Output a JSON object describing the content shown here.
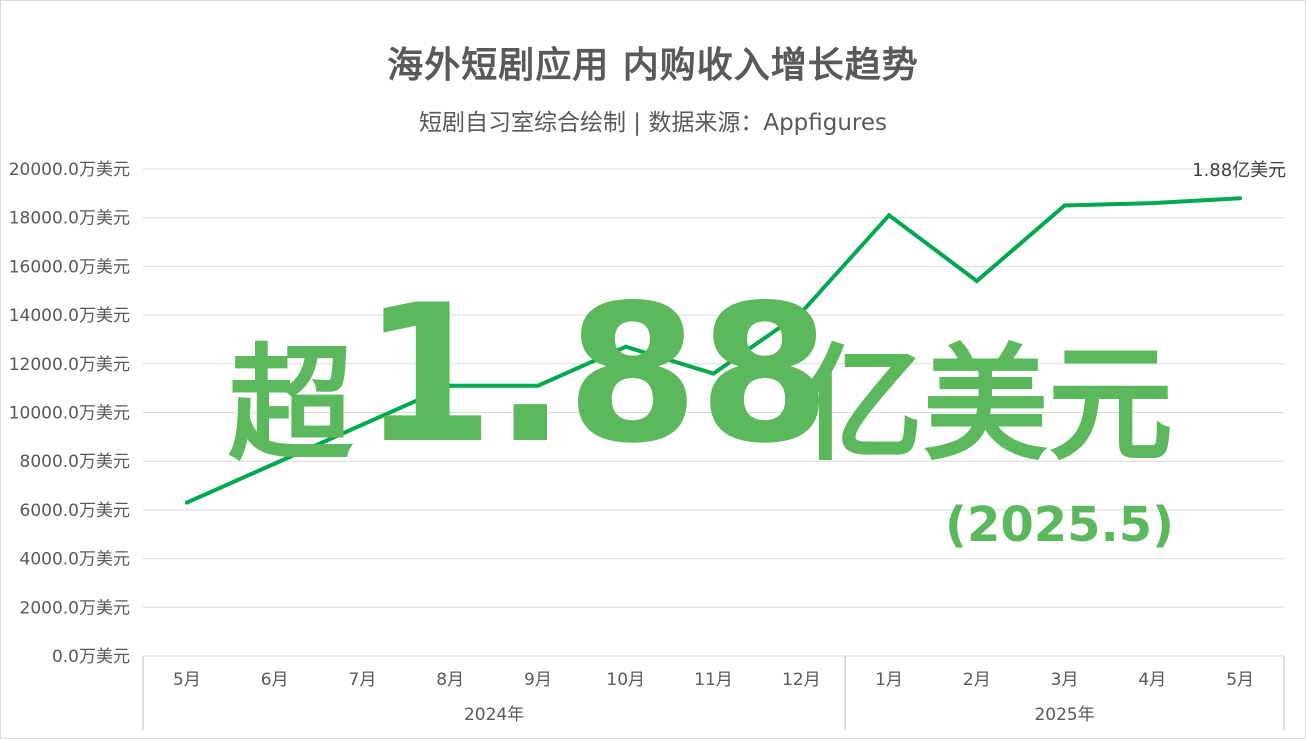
{
  "header": {
    "title": "海外短剧应用 内购收入增长趋势",
    "subtitle": "短剧自习室综合绘制 | 数据来源：Appfigures"
  },
  "overlay": {
    "prefix": "超",
    "number": "1.88",
    "unit": "亿美元",
    "date": "(2025.5)",
    "color": "#5cb85c"
  },
  "chart_data": {
    "type": "line",
    "line_color": "#00a84f",
    "grid": true,
    "ylim": [
      0,
      20000
    ],
    "y_ticks": [
      "0.0万美元",
      "2000.0万美元",
      "4000.0万美元",
      "6000.0万美元",
      "8000.0万美元",
      "10000.0万美元",
      "12000.0万美元",
      "14000.0万美元",
      "16000.0万美元",
      "18000.0万美元",
      "20000.0万美元"
    ],
    "y_tick_values": [
      0,
      2000,
      4000,
      6000,
      8000,
      10000,
      12000,
      14000,
      16000,
      18000,
      20000
    ],
    "categories": [
      "5月",
      "6月",
      "7月",
      "8月",
      "9月",
      "10月",
      "11月",
      "12月",
      "1月",
      "2月",
      "3月",
      "4月",
      "5月"
    ],
    "groups": [
      {
        "label": "2024年",
        "count": 8
      },
      {
        "label": "2025年",
        "count": 5
      }
    ],
    "series": [
      {
        "values": [
          6300,
          7900,
          9500,
          11100,
          11100,
          12700,
          11600,
          14100,
          18100,
          15400,
          18500,
          18600,
          18800
        ]
      }
    ],
    "end_label": "1.88亿美元"
  }
}
